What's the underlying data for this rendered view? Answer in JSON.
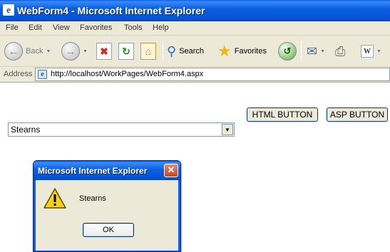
{
  "window": {
    "title": "WebForm4 - Microsoft Internet Explorer",
    "app_icon": "ie-page-icon"
  },
  "menu": [
    "File",
    "Edit",
    "View",
    "Favorites",
    "Tools",
    "Help"
  ],
  "toolbar": {
    "back_label": "Back",
    "search_label": "Search",
    "favorites_label": "Favorites"
  },
  "address": {
    "label": "Address",
    "url": "http://localhost/WorkPages/WebForm4.aspx"
  },
  "page": {
    "html_button_label": "HTML BUTTON",
    "asp_button_label": "ASP BUTTON",
    "dropdown_value": "Stearns"
  },
  "dialog": {
    "title": "Microsoft Internet Explorer",
    "message": "Stearns",
    "ok_label": "OK",
    "icon": "warning-icon"
  },
  "colors": {
    "titlebar_blue": "#0b5fe0",
    "chrome_gray": "#ece9d8",
    "close_red": "#c8431f"
  }
}
